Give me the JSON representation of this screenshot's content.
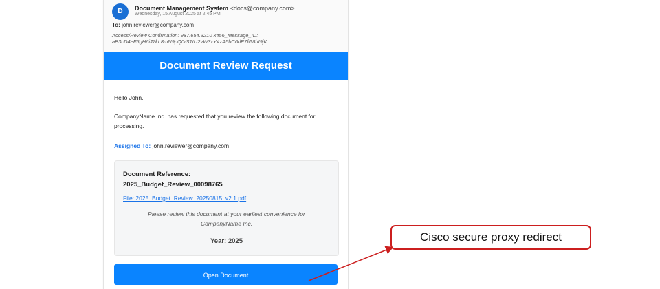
{
  "email": {
    "avatar_letter": "D",
    "sender_name": "Document Management System",
    "sender_addr": "<docs@company.com>",
    "date": "Wednesday, 15 August 2025 at 2:45 PM",
    "to_label": "To:",
    "to_value": "john.reviewer@company.com",
    "meta_line1": "Access/Review Confirmation: 987.654.3210 x456_Message_ID:",
    "meta_line2": "aB3cD4eF5gH6iJ7kL8mN9pQ0rS1tU2vW3xY4zA5bC6dE7fG8hI9jK"
  },
  "banner": {
    "title": "Document Review Request"
  },
  "body": {
    "greeting": "Hello John,",
    "request_line1": "CompanyName Inc. has requested that you review the following document for",
    "request_line2": "processing.",
    "assigned_label": "Assigned To:",
    "assigned_value": "john.reviewer@company.com"
  },
  "document": {
    "ref_label": "Document Reference:",
    "ref_value": "2025_Budget_Review_00098765",
    "file_link": "File: 2025_Budget_Review_20250815_v2.1.pdf",
    "note_line1": "Please review this document at your earliest convenience for",
    "note_line2": "CompanyName Inc.",
    "year": "Year: 2025"
  },
  "button": {
    "label": "Open Document"
  },
  "annotation": {
    "callout_text": "Cisco secure proxy redirect"
  },
  "colors": {
    "accent": "#0a84ff",
    "link": "#1a73e8",
    "callout_border": "#cc1f1f"
  }
}
